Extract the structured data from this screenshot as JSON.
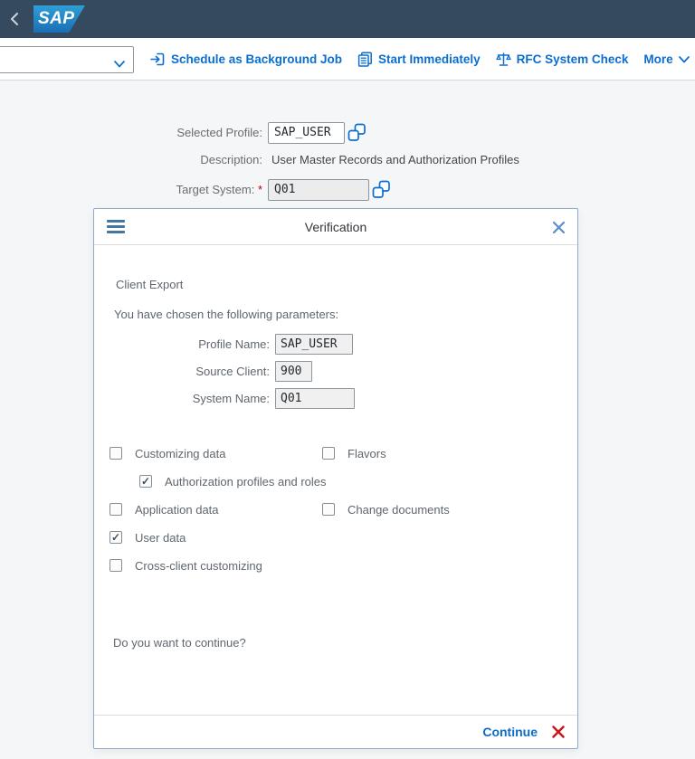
{
  "shellbar": {
    "logo_text": "SAP"
  },
  "toolbar": {
    "combobox_value": "",
    "buttons": [
      {
        "label": "Schedule as Background Job"
      },
      {
        "label": "Start Immediately"
      },
      {
        "label": "RFC System Check"
      },
      {
        "label": "More"
      }
    ]
  },
  "form": {
    "selected_profile": {
      "label": "Selected Profile:",
      "value": "SAP_USER"
    },
    "description": {
      "label": "Description:",
      "value": "User Master Records and Authorization Profiles"
    },
    "target_system": {
      "label": "Target System:",
      "required_mark": "*",
      "value": "Q01"
    }
  },
  "dialog": {
    "title": "Verification",
    "heading": "Client Export",
    "intro": "You have chosen the following parameters:",
    "params": [
      {
        "label": "Profile Name:",
        "value": "SAP_USER"
      },
      {
        "label": "Source Client:",
        "value": "900"
      },
      {
        "label": "System Name:",
        "value": "Q01"
      }
    ],
    "checkboxes": [
      {
        "label": "Customizing data",
        "checked": false,
        "mark": ""
      },
      {
        "label": "Flavors",
        "checked": false,
        "mark": ""
      },
      {
        "label": "Authorization profiles and roles",
        "checked": true,
        "mark": "✓"
      },
      {
        "label": "Application data",
        "checked": false,
        "mark": ""
      },
      {
        "label": "Change documents",
        "checked": false,
        "mark": ""
      },
      {
        "label": "User data",
        "checked": true,
        "mark": "✓"
      },
      {
        "label": "Cross-client customizing",
        "checked": false,
        "mark": ""
      }
    ],
    "question": "Do you want to continue?",
    "footer": {
      "continue_label": "Continue"
    }
  },
  "colors": {
    "shellbar_bg": "#354a5f",
    "accent_blue": "#0a6ed1",
    "logo_blue": "#1b74bd",
    "required_red": "#bb0000",
    "reject_red": "#c9191e",
    "page_bg": "#f5f6f7"
  }
}
